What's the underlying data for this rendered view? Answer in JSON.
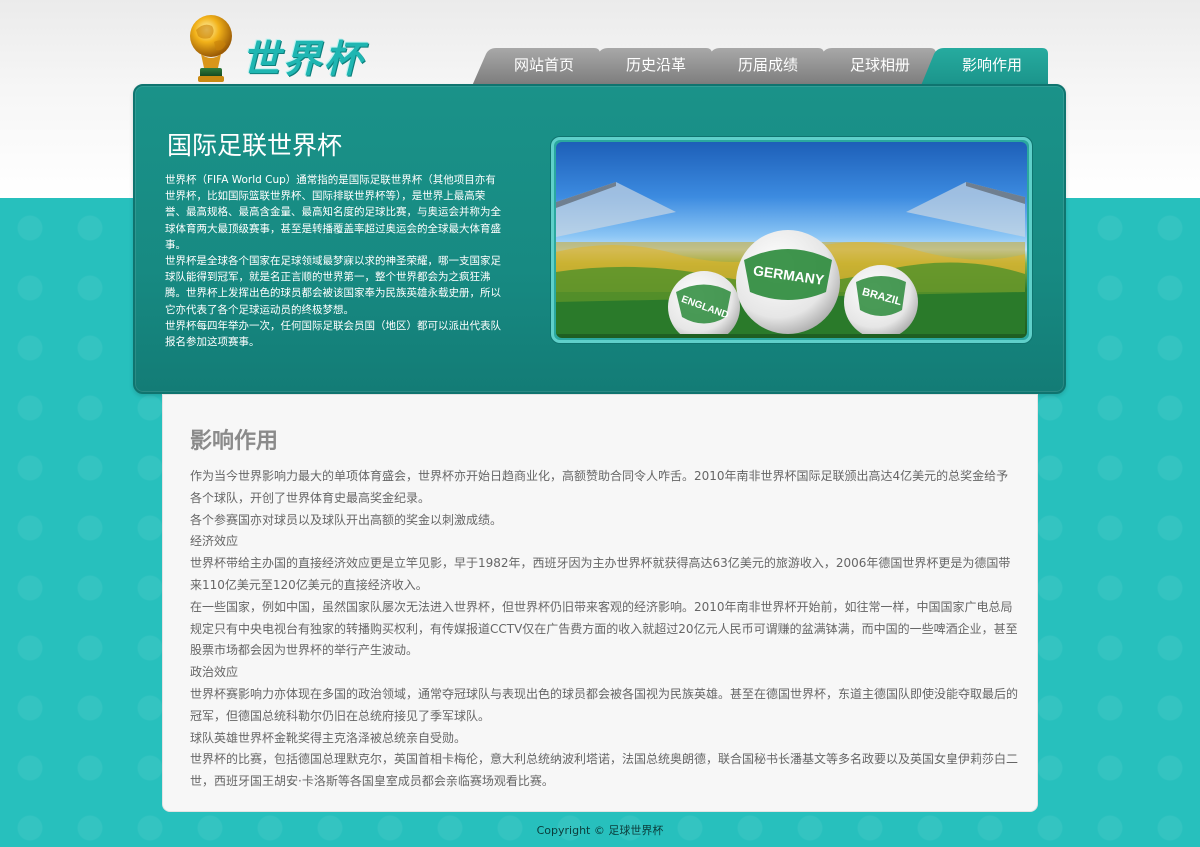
{
  "logo": {
    "text": "世界杯",
    "icon": "trophy-icon"
  },
  "nav": {
    "tabs": [
      {
        "label": "网站首页",
        "active": false
      },
      {
        "label": "历史沿革",
        "active": false
      },
      {
        "label": "历届成绩",
        "active": false
      },
      {
        "label": "足球相册",
        "active": false
      },
      {
        "label": "影响作用",
        "active": true
      }
    ]
  },
  "intro": {
    "title": "国际足联世界杯",
    "paragraphs": [
      "世界杯（FIFA World Cup）通常指的是国际足联世界杯（其他项目亦有世界杯，比如国际篮联世界杯、国际排联世界杯等），是世界上最高荣誉、最高规格、最高含金量、最高知名度的足球比赛，与奥运会并称为全球体育两大最顶级赛事，甚至是转播覆盖率超过奥运会的全球最大体育盛事。",
      "世界杯是全球各个国家在足球领域最梦寐以求的神圣荣耀，哪一支国家足球队能得到冠军，就是名正言顺的世界第一，整个世界都会为之疯狂沸腾。世界杯上发挥出色的球员都会被该国家奉为民族英雄永载史册，所以它亦代表了各个足球运动员的终极梦想。",
      "世界杯每四年举办一次，任何国际足联会员国（地区）都可以派出代表队报名参加这项赛事。"
    ],
    "image_labels": {
      "center": "GERMANY",
      "left": "ENGLAND",
      "right": "BRAZIL"
    }
  },
  "content": {
    "title": "影响作用",
    "paragraphs": [
      "作为当今世界影响力最大的单项体育盛会，世界杯亦开始日趋商业化，高额赞助合同令人咋舌。2010年南非世界杯国际足联颁出高达4亿美元的总奖金给予各个球队，开创了世界体育史最高奖金纪录。",
      "各个参赛国亦对球员以及球队开出高额的奖金以刺激成绩。",
      "经济效应",
      "世界杯带给主办国的直接经济效应更是立竿见影，早于1982年，西班牙因为主办世界杯就获得高达63亿美元的旅游收入，2006年德国世界杯更是为德国带来110亿美元至120亿美元的直接经济收入。",
      "在一些国家，例如中国，虽然国家队屡次无法进入世界杯，但世界杯仍旧带来客观的经济影响。2010年南非世界杯开始前，如往常一样，中国国家广电总局规定只有中央电视台有独家的转播购买权利，有传媒报道CCTV仅在广告费方面的收入就超过20亿元人民币可谓赚的盆满钵满，而中国的一些啤酒企业，甚至股票市场都会因为世界杯的举行产生波动。",
      "政治效应",
      "世界杯赛影响力亦体现在多国的政治领域，通常夺冠球队与表现出色的球员都会被各国视为民族英雄。甚至在德国世界杯，东道主德国队即使没能夺取最后的冠军，但德国总统科勒尔仍旧在总统府接见了季军球队。",
      "球队英雄世界杯金靴奖得主克洛泽被总统亲自受勋。",
      "世界杯的比赛，包括德国总理默克尔，英国首相卡梅伦，意大利总统纳波利塔诺，法国总统奥朗德，联合国秘书长潘基文等多名政要以及英国女皇伊莉莎白二世，西班牙国王胡安·卡洛斯等各国皇室成员都会亲临赛场观看比赛。"
    ]
  },
  "footer": {
    "text": "Copyright © 足球世界杯"
  },
  "colors": {
    "accent": "#1a9289",
    "background": "#27c0bd",
    "tab_active": "#1d9a90",
    "tab_inactive": "#8a8a8a"
  }
}
